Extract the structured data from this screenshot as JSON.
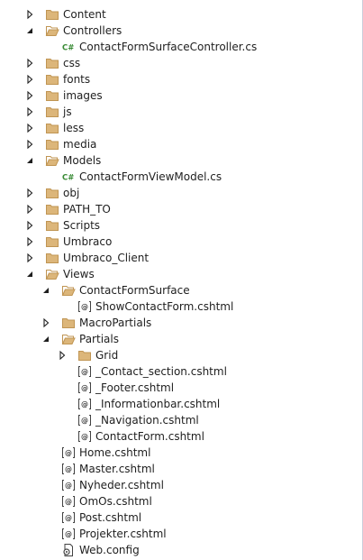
{
  "solution_explorer": {
    "items": [
      {
        "label": "Content",
        "icon": "folder-icon",
        "expander": "collapsed",
        "depth": 0
      },
      {
        "label": "Controllers",
        "icon": "folder-open-icon",
        "expander": "expanded",
        "depth": 0
      },
      {
        "label": "ContactFormSurfaceController.cs",
        "icon": "csharp-file-icon",
        "expander": "none",
        "depth": 1
      },
      {
        "label": "css",
        "icon": "folder-icon",
        "expander": "collapsed",
        "depth": 0
      },
      {
        "label": "fonts",
        "icon": "folder-icon",
        "expander": "collapsed",
        "depth": 0
      },
      {
        "label": "images",
        "icon": "folder-icon",
        "expander": "collapsed",
        "depth": 0
      },
      {
        "label": "js",
        "icon": "folder-icon",
        "expander": "collapsed",
        "depth": 0
      },
      {
        "label": "less",
        "icon": "folder-icon",
        "expander": "collapsed",
        "depth": 0
      },
      {
        "label": "media",
        "icon": "folder-icon",
        "expander": "collapsed",
        "depth": 0
      },
      {
        "label": "Models",
        "icon": "folder-open-icon",
        "expander": "expanded",
        "depth": 0
      },
      {
        "label": "ContactFormViewModel.cs",
        "icon": "csharp-file-icon",
        "expander": "none",
        "depth": 1
      },
      {
        "label": "obj",
        "icon": "folder-icon",
        "expander": "collapsed",
        "depth": 0
      },
      {
        "label": "PATH_TO",
        "icon": "folder-icon",
        "expander": "collapsed",
        "depth": 0
      },
      {
        "label": "Scripts",
        "icon": "folder-icon",
        "expander": "collapsed",
        "depth": 0
      },
      {
        "label": "Umbraco",
        "icon": "folder-icon",
        "expander": "collapsed",
        "depth": 0
      },
      {
        "label": "Umbraco_Client",
        "icon": "folder-icon",
        "expander": "collapsed",
        "depth": 0
      },
      {
        "label": "Views",
        "icon": "folder-open-icon",
        "expander": "expanded",
        "depth": 0
      },
      {
        "label": "ContactFormSurface",
        "icon": "folder-open-icon",
        "expander": "expanded",
        "depth": 1
      },
      {
        "label": "ShowContactForm.cshtml",
        "icon": "razor-file-icon",
        "expander": "none",
        "depth": 2
      },
      {
        "label": "MacroPartials",
        "icon": "folder-icon",
        "expander": "collapsed",
        "depth": 1
      },
      {
        "label": "Partials",
        "icon": "folder-open-icon",
        "expander": "expanded",
        "depth": 1
      },
      {
        "label": "Grid",
        "icon": "folder-icon",
        "expander": "collapsed",
        "depth": 2
      },
      {
        "label": "_Contact_section.cshtml",
        "icon": "razor-file-icon",
        "expander": "none",
        "depth": 2
      },
      {
        "label": "_Footer.cshtml",
        "icon": "razor-file-icon",
        "expander": "none",
        "depth": 2
      },
      {
        "label": "_Informationbar.cshtml",
        "icon": "razor-file-icon",
        "expander": "none",
        "depth": 2
      },
      {
        "label": "_Navigation.cshtml",
        "icon": "razor-file-icon",
        "expander": "none",
        "depth": 2
      },
      {
        "label": "ContactForm.cshtml",
        "icon": "razor-file-icon",
        "expander": "none",
        "depth": 2
      },
      {
        "label": "Home.cshtml",
        "icon": "razor-file-icon",
        "expander": "none",
        "depth": 1
      },
      {
        "label": "Master.cshtml",
        "icon": "razor-file-icon",
        "expander": "none",
        "depth": 1
      },
      {
        "label": "Nyheder.cshtml",
        "icon": "razor-file-icon",
        "expander": "none",
        "depth": 1
      },
      {
        "label": "OmOs.cshtml",
        "icon": "razor-file-icon",
        "expander": "none",
        "depth": 1
      },
      {
        "label": "Post.cshtml",
        "icon": "razor-file-icon",
        "expander": "none",
        "depth": 1
      },
      {
        "label": "Projekter.cshtml",
        "icon": "razor-file-icon",
        "expander": "none",
        "depth": 1
      },
      {
        "label": "Web.config",
        "icon": "config-file-icon",
        "expander": "none",
        "depth": 1
      }
    ]
  },
  "colors": {
    "folder": "#dcb67a",
    "folder_dark": "#c09553",
    "expander": "#1e1e1e",
    "csharp": "#388a34",
    "text": "#1e1e1e"
  }
}
